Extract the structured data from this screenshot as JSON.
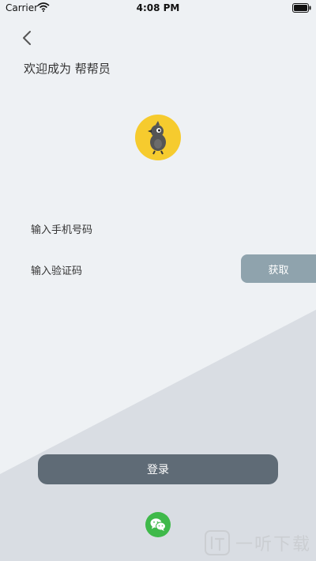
{
  "status_bar": {
    "carrier": "Carrier",
    "time": "4:08 PM"
  },
  "header": {
    "welcome_text": "欢迎成为 帮帮员"
  },
  "form": {
    "phone_label": "输入手机号码",
    "code_label": "输入验证码",
    "get_code_label": "获取"
  },
  "actions": {
    "login_label": "登录"
  },
  "watermark": {
    "text": "一听下载"
  },
  "colors": {
    "background": "#eef1f4",
    "wedge": "#d9dde3",
    "get_code_button": "#8fa3ad",
    "login_button": "#5f6b76",
    "avatar": "#f6cb2e",
    "wechat": "#3fb94a"
  },
  "icons": {
    "back": "chevron-left-icon",
    "wifi": "wifi-icon",
    "battery": "battery-icon",
    "avatar": "bird-mascot-icon",
    "wechat": "wechat-icon"
  }
}
